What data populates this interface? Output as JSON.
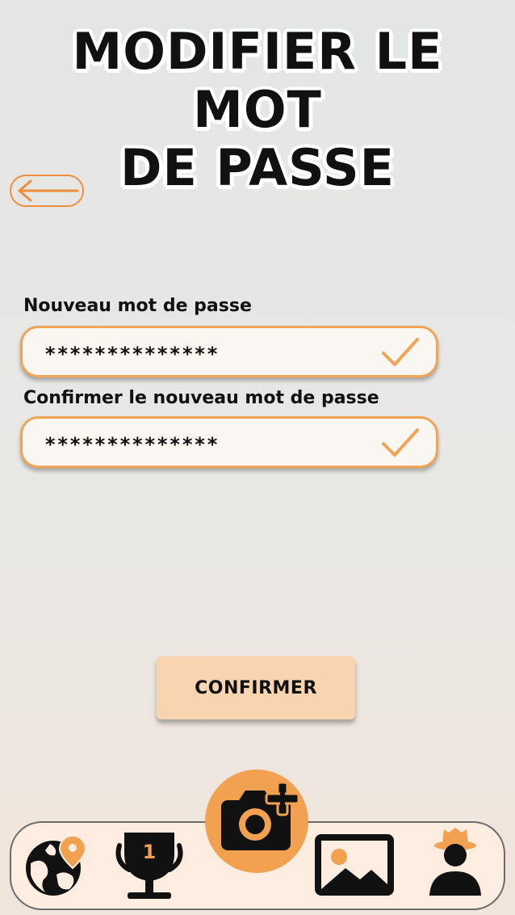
{
  "title": {
    "line1": "MODIFIER LE MOT",
    "line2": "DE PASSE"
  },
  "back": {
    "icon": "arrow-left-icon"
  },
  "form": {
    "new_password": {
      "label": "Nouveau mot de passe",
      "value": "**************",
      "valid_icon": "checkmark-icon"
    },
    "confirm_password": {
      "label": "Confirmer le nouveau mot de passe",
      "value": "**************",
      "valid_icon": "checkmark-icon"
    },
    "submit_label": "CONFIRMER"
  },
  "nav": {
    "items": [
      {
        "icon": "world-map-pin-icon"
      },
      {
        "icon": "trophy-icon",
        "badge": "1"
      },
      {
        "icon": "camera-add-icon"
      },
      {
        "icon": "image-gallery-icon"
      },
      {
        "icon": "cowboy-profile-icon"
      }
    ]
  },
  "colors": {
    "accent": "#f2a151",
    "accent_dark": "#ef8f3c",
    "field_bg": "#faf6f1",
    "button_bg": "#f8d5b0",
    "nav_bg": "#fcede0"
  }
}
